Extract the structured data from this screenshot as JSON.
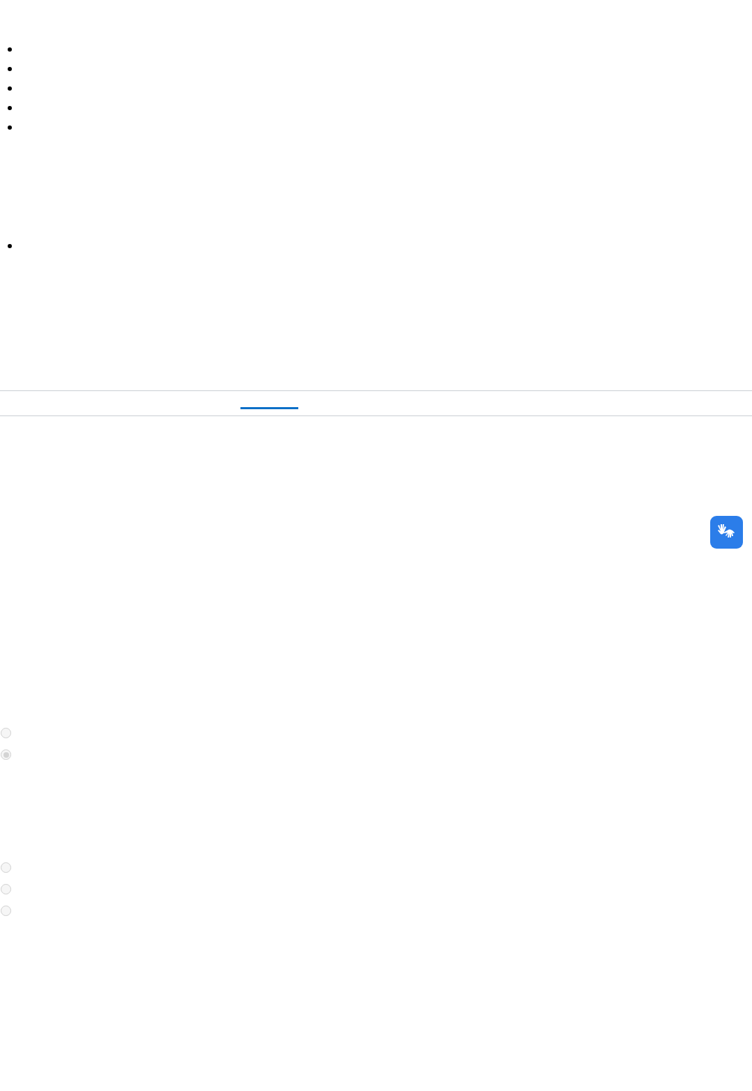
{
  "bullet_lists": [
    {
      "items": [
        {
          "kind": "bullet"
        },
        {
          "kind": "bullet"
        },
        {
          "kind": "bullet"
        },
        {
          "kind": "bullet"
        },
        {
          "kind": "bullet"
        }
      ]
    },
    {
      "items": [
        {
          "kind": "bullet"
        }
      ]
    }
  ],
  "tabs": [
    {
      "selected": true
    }
  ],
  "accessibility_button": {
    "kind": "sign-language"
  },
  "radio_groups": [
    {
      "options": [
        {
          "selected": false
        },
        {
          "selected": true
        }
      ]
    },
    {
      "options": [
        {
          "selected": false
        },
        {
          "selected": false
        },
        {
          "selected": false
        }
      ]
    }
  ]
}
